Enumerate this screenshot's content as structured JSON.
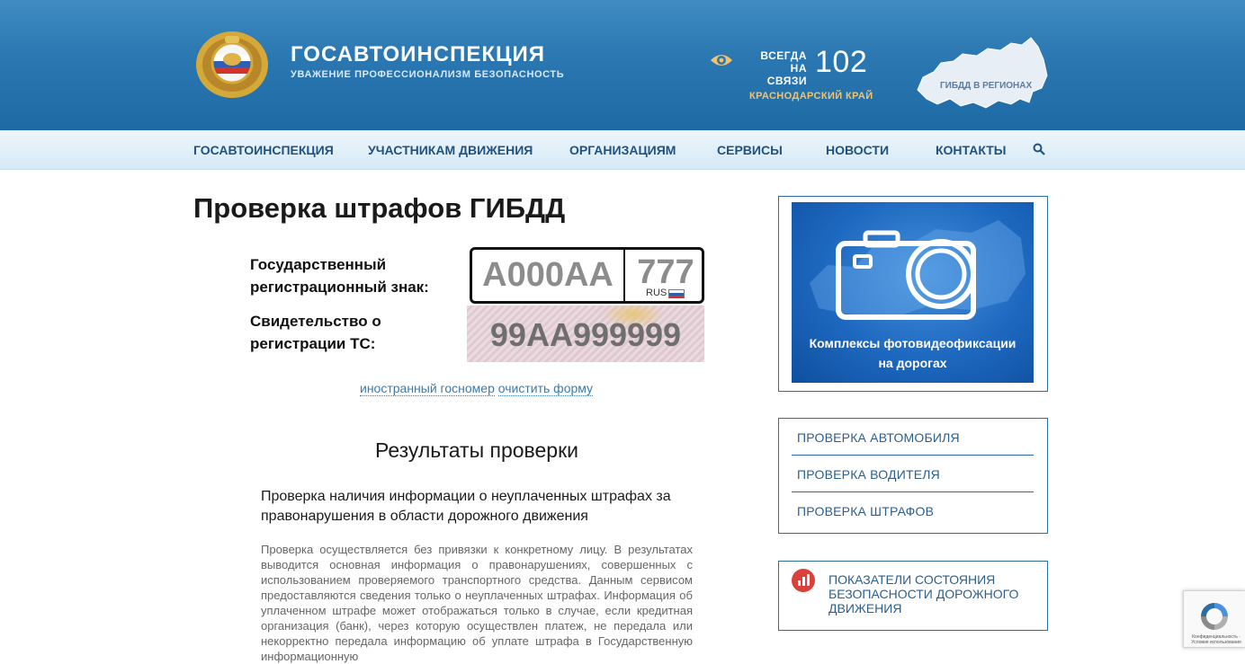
{
  "header": {
    "brand_title": "ГОСАВТОИНСПЕКЦИЯ",
    "brand_subtitle": "УВАЖЕНИЕ ПРОФЕССИОНАЛИЗМ БЕЗОПАСНОСТЬ",
    "always_line1": "ВСЕГДА",
    "always_line2": "НА СВЯЗИ",
    "phone": "102",
    "region": "КРАСНОДАРСКИЙ КРАЙ",
    "map_label": "ГИБДД В РЕГИОНАХ"
  },
  "nav": {
    "items": [
      {
        "label": "ГОСАВТОИНСПЕКЦИЯ"
      },
      {
        "label": "УЧАСТНИКАМ ДВИЖЕНИЯ"
      },
      {
        "label": "ОРГАНИЗАЦИЯМ"
      },
      {
        "label": "СЕРВИСЫ"
      },
      {
        "label": "НОВОСТИ"
      },
      {
        "label": "КОНТАКТЫ"
      }
    ],
    "search_icon": "search-icon"
  },
  "main": {
    "title": "Проверка штрафов ГИБДД",
    "plate_label_1": "Государственный",
    "plate_label_2": "регистрационный знак:",
    "plate_number": "А000АА",
    "plate_region": "777",
    "plate_country": "RUS",
    "cert_label_1": "Свидетельство о",
    "cert_label_2": "регистрации ТС:",
    "cert_number": "99АА999999",
    "link_foreign": "иностранный госномер",
    "link_clear": "очистить форму",
    "results_title": "Результаты проверки",
    "sub_title": "Проверка наличия информации о неуплаченных штрафах за правонарушения в области дорожного движения",
    "description": "Проверка осуществляется без привязки к конкретному лицу. В результатах выводится основная информация о правонарушениях, совершенных с использованием проверяемого транспортного средства. Данным сервисом предоставляются сведения только о неуплаченных штрафах. Информация об уплаченном штрафе может отображаться только в случае, если кредитная организация (банк), через которую осуществлен платеж, не передала или некорректно передала информацию об уплате штрафа в Государственную информационную"
  },
  "sidebar": {
    "banner_text_1": "Комплексы фотовидеофиксации",
    "banner_text_2": "на дорогах",
    "links": [
      {
        "label": "ПРОВЕРКА АВТОМОБИЛЯ"
      },
      {
        "label": "ПРОВЕРКА ВОДИТЕЛЯ"
      },
      {
        "label": "ПРОВЕРКА ШТРАФОВ"
      }
    ],
    "stats_text": "ПОКАЗАТЕЛИ СОСТОЯНИЯ БЕЗОПАСНОСТИ ДОРОЖНОГО ДВИЖЕНИЯ"
  },
  "recaptcha": {
    "text": "Конфиденциальность - Условия использования"
  },
  "colors": {
    "header_blue": "#2a77b1",
    "nav_text": "#21527f",
    "accent_gold": "#f2c36b",
    "link_blue": "#3f79a8"
  }
}
